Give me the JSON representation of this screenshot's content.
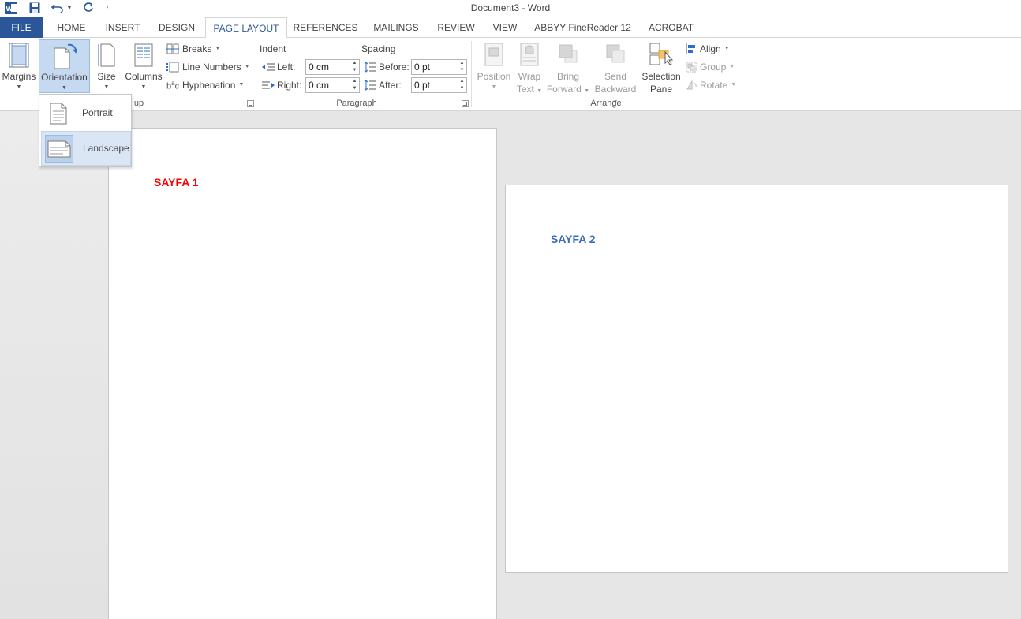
{
  "window": {
    "title": "Document3 - Word"
  },
  "quick_access": [
    "word-app-icon",
    "save-icon",
    "undo-icon",
    "undo-dropdown-icon",
    "redo-icon",
    "customize-qat-icon"
  ],
  "tabs": [
    "FILE",
    "HOME",
    "INSERT",
    "DESIGN",
    "PAGE LAYOUT",
    "REFERENCES",
    "MAILINGS",
    "REVIEW",
    "VIEW",
    "ABBYY FineReader 12",
    "ACROBAT"
  ],
  "active_tab": "PAGE LAYOUT",
  "ribbon": {
    "page_setup": {
      "margins": "Margins",
      "orientation": "Orientation",
      "size": "Size",
      "columns": "Columns",
      "breaks": "Breaks",
      "line_numbers": "Line Numbers",
      "hyphenation": "Hyphenation",
      "group_label": "up"
    },
    "paragraph": {
      "indent_heading": "Indent",
      "spacing_heading": "Spacing",
      "left_label": "Left:",
      "right_label": "Right:",
      "before_label": "Before:",
      "after_label": "After:",
      "left_value": "0 cm",
      "right_value": "0 cm",
      "before_value": "0 pt",
      "after_value": "0 pt",
      "group_label": "Paragraph"
    },
    "arrange": {
      "position": "Position",
      "wrap_text_1": "Wrap",
      "wrap_text_2": "Text",
      "bring_forward_1": "Bring",
      "bring_forward_2": "Forward",
      "send_backward_1": "Send",
      "send_backward_2": "Backward",
      "selection_pane_1": "Selection",
      "selection_pane_2": "Pane",
      "align": "Align",
      "group": "Group",
      "rotate": "Rotate",
      "group_label": "Arrange"
    }
  },
  "orientation_menu": {
    "items": [
      "Portrait",
      "Landscape"
    ],
    "selected": "Landscape"
  },
  "document": {
    "page1_text": "SAYFA 1",
    "page2_text": "SAYFA 2",
    "page1_color": "#ff0000",
    "page2_color": "#3b6dbf"
  },
  "colors": {
    "file_tab": "#2b579a",
    "accent": "#2b579a"
  }
}
